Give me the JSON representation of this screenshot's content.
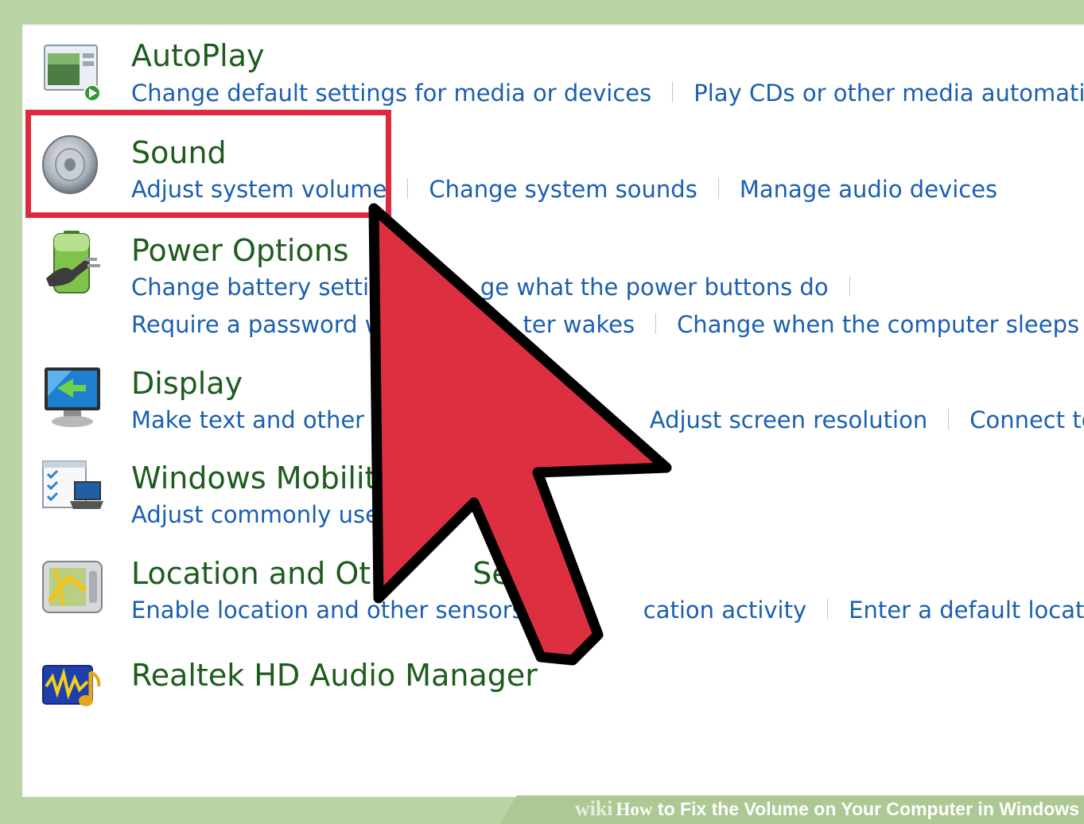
{
  "categories": [
    {
      "key": "autoplay",
      "title": "AutoPlay",
      "icon": "autoplay-icon",
      "rows": [
        [
          "Change default settings for media or devices",
          "Play CDs or other media automatically"
        ]
      ]
    },
    {
      "key": "sound",
      "title": "Sound",
      "icon": "speaker-icon",
      "rows": [
        [
          "Adjust system volume",
          "Change system sounds",
          "Manage audio devices"
        ]
      ]
    },
    {
      "key": "power-options",
      "title": "Power Options",
      "icon": "power-plug-battery-icon",
      "rows": [
        [
          "Change battery setting",
          "ge what the power buttons do"
        ],
        [
          "Require a password w",
          "ter wakes",
          "Change when the computer sleeps"
        ]
      ]
    },
    {
      "key": "display",
      "title": "Display",
      "icon": "display-monitor-icon",
      "rows": [
        [
          "Make text and other it",
          "Adjust screen resolution",
          "Connect to an"
        ]
      ]
    },
    {
      "key": "windows-mobility",
      "title": "Windows Mobilit",
      "icon": "mobility-center-icon",
      "rows": [
        [
          "Adjust commonly use"
        ]
      ]
    },
    {
      "key": "location-sensors",
      "title": "Location and Oth",
      "title_tail": "Senso",
      "icon": "location-sensor-icon",
      "rows": [
        [
          "Enable location and other sensors",
          "cation activity",
          "Enter a default location"
        ]
      ]
    },
    {
      "key": "realtek",
      "title": "Realtek HD Audio Manager",
      "icon": "realtek-audio-icon",
      "rows": []
    }
  ],
  "annotation": {
    "highlight_color": "#de2a3a",
    "cursor_color": "#dc3040"
  },
  "watermark": {
    "brand": "wiki",
    "how": "How",
    "text": "to Fix the Volume on Your Computer in Windows"
  }
}
